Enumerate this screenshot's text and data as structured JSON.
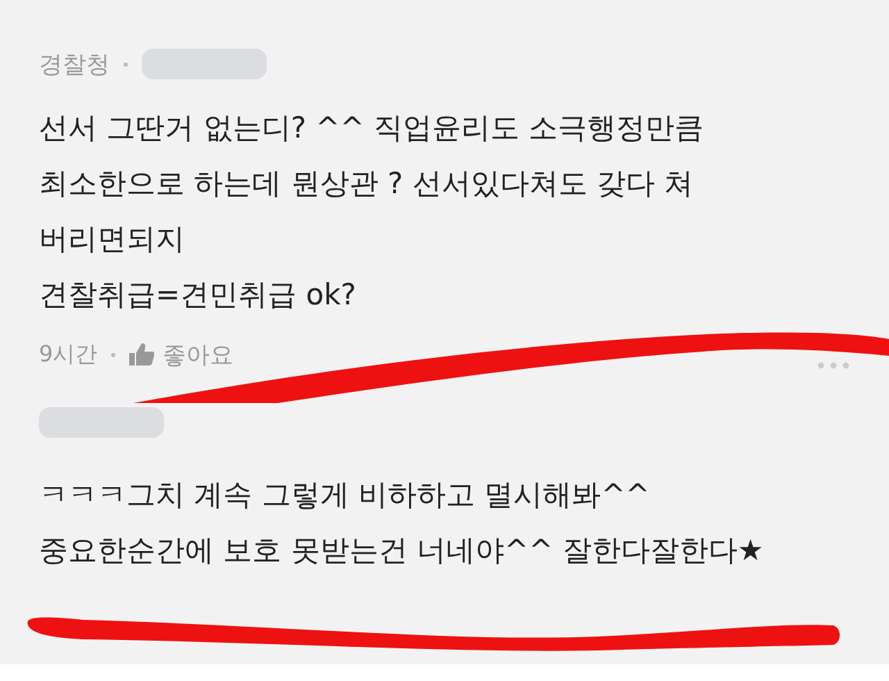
{
  "comments": [
    {
      "author": "경찰청",
      "lines": [
        "선서 그딴거 없는디? ^^ 직업윤리도 소극행정만큼",
        "최소한으로 하는데 뭔상관 ? 선서있다쳐도 갖다 쳐",
        "버리면되지",
        "견찰취급=견민취급 ok?"
      ],
      "time": "9시간",
      "like_label": "좋아요"
    },
    {
      "lines": [
        "ㅋㅋㅋ그치 계속 그렇게 비하하고 멸시해봐^^",
        "중요한순간에 보호 못받는건 너네야^^ 잘한다잘한다★"
      ]
    }
  ]
}
